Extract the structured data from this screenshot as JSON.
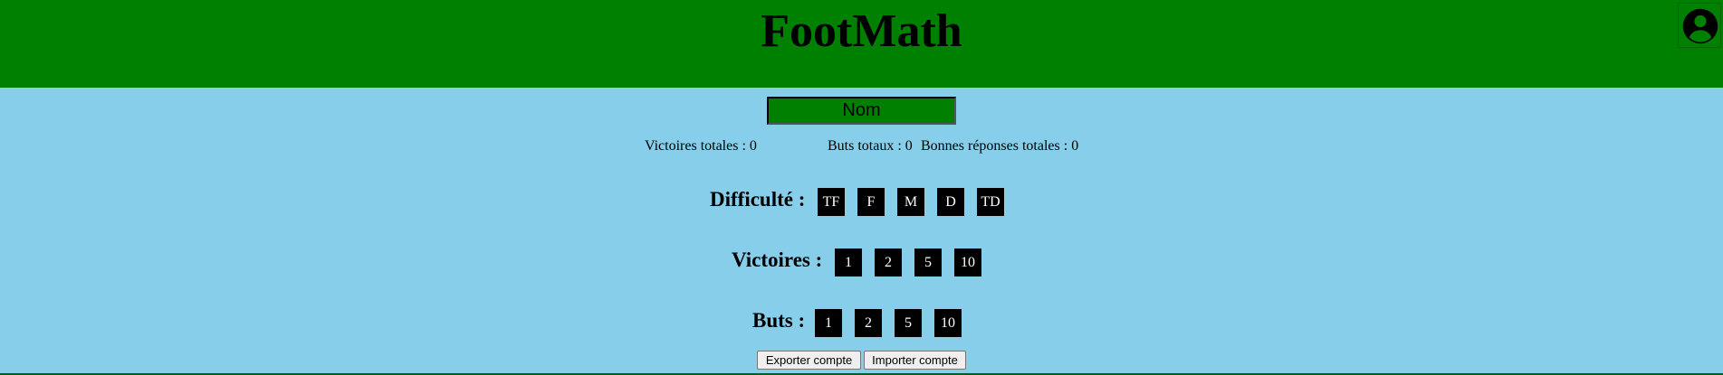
{
  "header": {
    "title": "FootMath",
    "account_icon": "account-circle-icon",
    "color": "#008000"
  },
  "name_field": {
    "placeholder": "Nom"
  },
  "stats": {
    "victories": "Victoires totales : 0",
    "goals": "Buts totaux : 0",
    "answers": "Bonnes réponses totales : 0"
  },
  "difficulty": {
    "label": "Difficulté :",
    "options": [
      "TF",
      "F",
      "M",
      "D",
      "TD"
    ]
  },
  "victories_setting": {
    "label": "Victoires :",
    "options": [
      "1",
      "2",
      "5",
      "10"
    ]
  },
  "goals_setting": {
    "label": "Buts :",
    "options": [
      "1",
      "2",
      "5",
      "10"
    ]
  },
  "actions": {
    "export_label": "Exporter compte",
    "import_label": "Importer compte"
  },
  "colors": {
    "background": "#87ceeb",
    "header": "#008000",
    "option_button": "#000000"
  }
}
